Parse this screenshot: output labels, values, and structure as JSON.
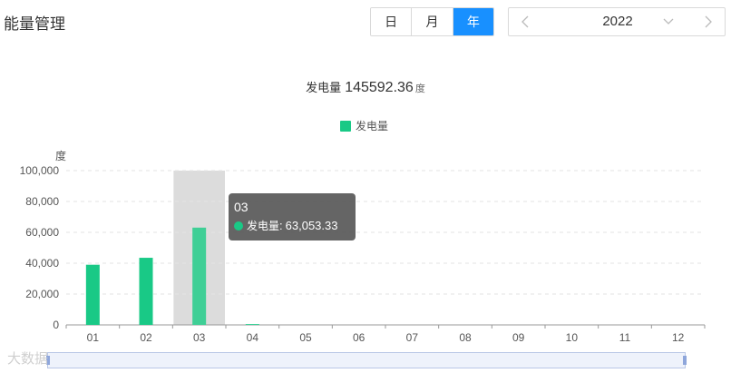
{
  "page": {
    "title": "能量管理"
  },
  "period_tabs": [
    {
      "label": "日",
      "active": false
    },
    {
      "label": "月",
      "active": false
    },
    {
      "label": "年",
      "active": true
    }
  ],
  "year_picker": {
    "value": "2022",
    "prev_icon": "chevron-left-icon",
    "dropdown_icon": "chevron-down-icon",
    "next_icon": "chevron-right-icon"
  },
  "summary": {
    "label": "发电量",
    "value": "145592.36",
    "unit": "度"
  },
  "legend": {
    "label": "发电量",
    "color": "#19c986"
  },
  "chart_data": {
    "type": "bar",
    "ylabel": "度",
    "ylim": [
      0,
      100000
    ],
    "yticks": [
      "0",
      "20,000",
      "40,000",
      "60,000",
      "80,000",
      "100,000"
    ],
    "categories": [
      "01",
      "02",
      "03",
      "04",
      "05",
      "06",
      "07",
      "08",
      "09",
      "10",
      "11",
      "12"
    ],
    "series": [
      {
        "name": "发电量",
        "color": "#19c986",
        "values": [
          39000,
          43500,
          63053.33,
          500,
          0,
          0,
          0,
          0,
          0,
          0,
          0,
          0
        ]
      }
    ],
    "highlight_index": 2,
    "grid": true
  },
  "tooltip": {
    "title": "03",
    "name": "发电量",
    "separator": ":",
    "value": "63,053.33"
  },
  "watermark": {
    "text": "大数据"
  }
}
